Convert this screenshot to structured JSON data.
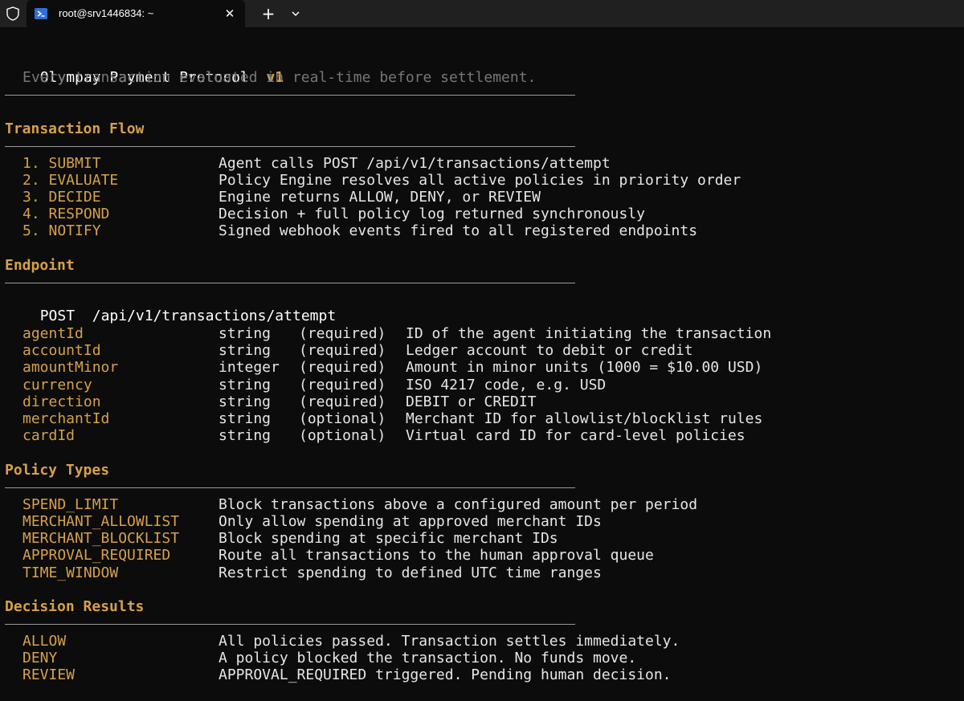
{
  "window": {
    "tab_title": "root@srv1446834: ~",
    "close_symbol": "✕",
    "new_tab_symbol": "+"
  },
  "header": {
    "title": "Olympay Payment Protocol",
    "version": "v1",
    "subtitle": "Every transaction evaluated in real-time before settlement."
  },
  "flow": {
    "heading": "Transaction Flow",
    "steps": [
      {
        "step": "1. SUBMIT",
        "desc": "Agent calls POST /api/v1/transactions/attempt"
      },
      {
        "step": "2. EVALUATE",
        "desc": "Policy Engine resolves all active policies in priority order"
      },
      {
        "step": "3. DECIDE",
        "desc": "Engine returns ALLOW, DENY, or REVIEW"
      },
      {
        "step": "4. RESPOND",
        "desc": "Decision + full policy log returned synchronously"
      },
      {
        "step": "5. NOTIFY",
        "desc": "Signed webhook events fired to all registered endpoints"
      }
    ]
  },
  "endpoint": {
    "heading": "Endpoint",
    "method": "POST",
    "path": "/api/v1/transactions/attempt",
    "params": [
      {
        "name": "agentId",
        "type": "string",
        "req": "(required)",
        "desc": "ID of the agent initiating the transaction"
      },
      {
        "name": "accountId",
        "type": "string",
        "req": "(required)",
        "desc": "Ledger account to debit or credit"
      },
      {
        "name": "amountMinor",
        "type": "integer",
        "req": "(required)",
        "desc": "Amount in minor units (1000 = $10.00 USD)"
      },
      {
        "name": "currency",
        "type": "string",
        "req": "(required)",
        "desc": "ISO 4217 code, e.g. USD"
      },
      {
        "name": "direction",
        "type": "string",
        "req": "(required)",
        "desc": "DEBIT or CREDIT"
      },
      {
        "name": "merchantId",
        "type": "string",
        "req": "(optional)",
        "desc": "Merchant ID for allowlist/blocklist rules"
      },
      {
        "name": "cardId",
        "type": "string",
        "req": "(optional)",
        "desc": "Virtual card ID for card-level policies"
      }
    ]
  },
  "policy_types": {
    "heading": "Policy Types",
    "items": [
      {
        "name": "SPEND_LIMIT",
        "desc": "Block transactions above a configured amount per period"
      },
      {
        "name": "MERCHANT_ALLOWLIST",
        "desc": "Only allow spending at approved merchant IDs"
      },
      {
        "name": "MERCHANT_BLOCKLIST",
        "desc": "Block spending at specific merchant IDs"
      },
      {
        "name": "APPROVAL_REQUIRED",
        "desc": "Route all transactions to the human approval queue"
      },
      {
        "name": "TIME_WINDOW",
        "desc": "Restrict spending to defined UTC time ranges"
      }
    ]
  },
  "decisions": {
    "heading": "Decision Results",
    "items": [
      {
        "name": "ALLOW",
        "desc": "All policies passed. Transaction settles immediately."
      },
      {
        "name": "DENY",
        "desc": "A policy blocked the transaction. No funds move."
      },
      {
        "name": "REVIEW",
        "desc": "APPROVAL_REQUIRED triggered. Pending human decision."
      }
    ]
  },
  "colors": {
    "background": "#0c0c0c",
    "accent": "#d6a04c",
    "text": "#e6e6e6",
    "muted": "#767676",
    "tabbar": "#202020"
  }
}
